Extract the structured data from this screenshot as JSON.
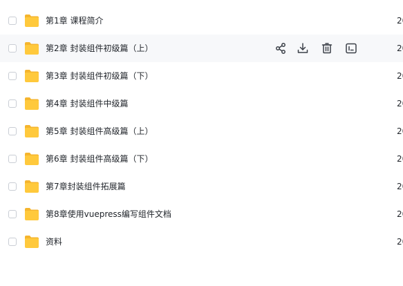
{
  "files": [
    {
      "name": "第1章 课程简介",
      "date": "20"
    },
    {
      "name": "第2章 封装组件初级篇（上）",
      "date": "20"
    },
    {
      "name": "第3章 封装组件初级篇（下）",
      "date": "20"
    },
    {
      "name": "第4章 封装组件中级篇",
      "date": "20"
    },
    {
      "name": "第5章 封装组件高级篇（上）",
      "date": "20"
    },
    {
      "name": "第6章 封装组件高级篇（下）",
      "date": "20"
    },
    {
      "name": "第7章封装组件拓展篇",
      "date": "20"
    },
    {
      "name": "第8章使用vuepress编写组件文档",
      "date": "20"
    },
    {
      "name": "资料",
      "date": "20"
    }
  ],
  "hovered_row_actions": [
    {
      "icon": "share-icon"
    },
    {
      "icon": "download-icon"
    },
    {
      "icon": "delete-icon"
    },
    {
      "icon": "rename-icon"
    }
  ],
  "colors": {
    "folder": "#ffc93c",
    "folder_tab": "#f5b52e",
    "text": "#1f2329",
    "hover_bg": "#f7f8fa",
    "icon": "#3a3f47"
  }
}
